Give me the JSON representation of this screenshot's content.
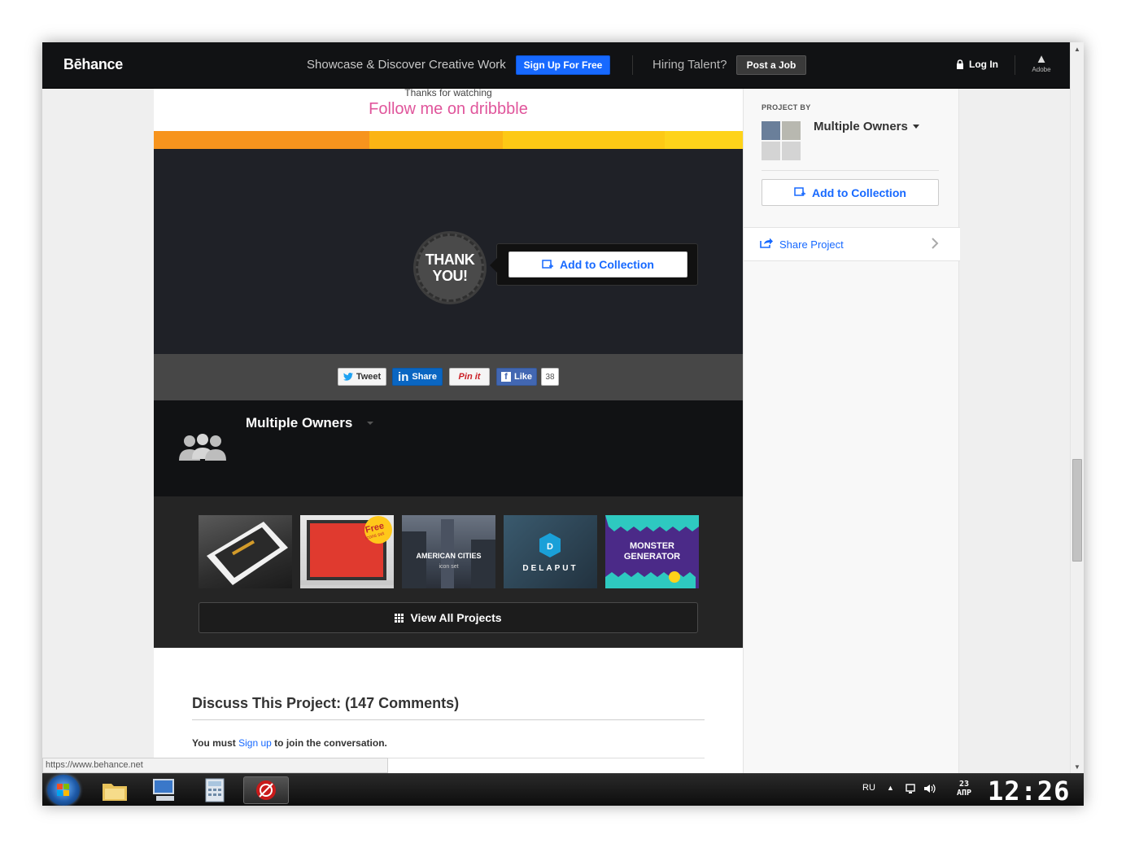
{
  "header": {
    "logo": "Bēhance",
    "tagline": "Showcase & Discover Creative Work",
    "signup_label": "Sign Up For Free",
    "hiring_text": "Hiring Talent?",
    "post_job_label": "Post a Job",
    "login_label": "Log In",
    "adobe_label": "Adobe"
  },
  "project": {
    "thanks_text": "Thanks for watching",
    "follow_text": "Follow me on dribbble",
    "stripe_colors": [
      "#f7941d",
      "#fbb414",
      "#fdc915",
      "#fed31a"
    ],
    "thank_badge": [
      "THANK",
      "YOU!"
    ],
    "add_to_collection_label": "Add to Collection",
    "share": {
      "tweet_label": "Tweet",
      "linkedin_label": "Share",
      "pin_label": "Pin it",
      "like_label": "Like",
      "like_count": "38"
    },
    "owner_name": "Multiple Owners",
    "thumbnails": [
      {
        "title": ""
      },
      {
        "title": "Free",
        "subtitle": "icons set"
      },
      {
        "title": "AMERICAN CITIES",
        "subtitle": "icon set"
      },
      {
        "title": "DELAPUT"
      },
      {
        "title": "MONSTER",
        "subtitle": "GENERATOR"
      }
    ],
    "view_all_label": "View All Projects",
    "discuss_title": "Discuss This Project: (147 Comments)",
    "discuss_prefix": "You must",
    "discuss_link": "Sign up",
    "discuss_suffix": "to join the conversation."
  },
  "sidebar": {
    "project_by_label": "PROJECT BY",
    "owner_name": "Multiple Owners",
    "add_to_collection_label": "Add to Collection",
    "share_project_label": "Share Project"
  },
  "status_url": "https://www.behance.net",
  "taskbar": {
    "lang": "RU",
    "date_day": "23",
    "date_month": "АПР",
    "time": "12:26"
  },
  "colors": {
    "brand_blue": "#1769ff",
    "follow_pink": "#e0559b"
  }
}
